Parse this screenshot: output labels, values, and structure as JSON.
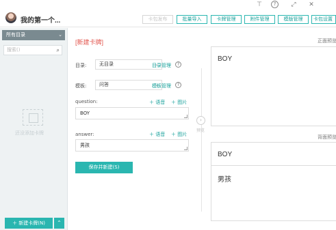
{
  "header": {
    "deck_title": "我的第一个...",
    "buttons": {
      "publish": "卡包发布",
      "bulk_import": "批量导入",
      "card_manage": "卡牌管理",
      "attachment_manage": "附件管理",
      "template_manage": "模版管理",
      "deck_settings": "卡包设置"
    }
  },
  "titlebar": {
    "icons": [
      "pin-icon",
      "help-icon",
      "expand-icon",
      "close-icon"
    ]
  },
  "sidebar": {
    "directory_header": "所有目录",
    "search_placeholder": "搜索()",
    "empty_text": "还没添加卡牌",
    "new_card_button": "＋ 新建卡牌(N)"
  },
  "editor": {
    "section_title": "[新建卡牌]",
    "directory_label": "目录:",
    "directory_value": "无目录",
    "directory_manage": "目录管理",
    "template_label": "模板:",
    "template_value": "问答",
    "template_manage": "模板管理",
    "question_label": "question:",
    "question_value": "BOY",
    "answer_label": "answer:",
    "answer_value": "男孩",
    "add_voice": "＋ 语音",
    "add_image": "＋ 图片",
    "save_button": "保存并新建(S)"
  },
  "preview": {
    "toggle_label": "预览",
    "front_label": "正面预览",
    "front_text": "BOY",
    "back_label": "背面预览",
    "back_question": "BOY",
    "back_answer": "男孩"
  },
  "colors": {
    "accent": "#2ab6b0",
    "title_red": "#e2534b",
    "sidebar_bg": "#eef2f3"
  }
}
